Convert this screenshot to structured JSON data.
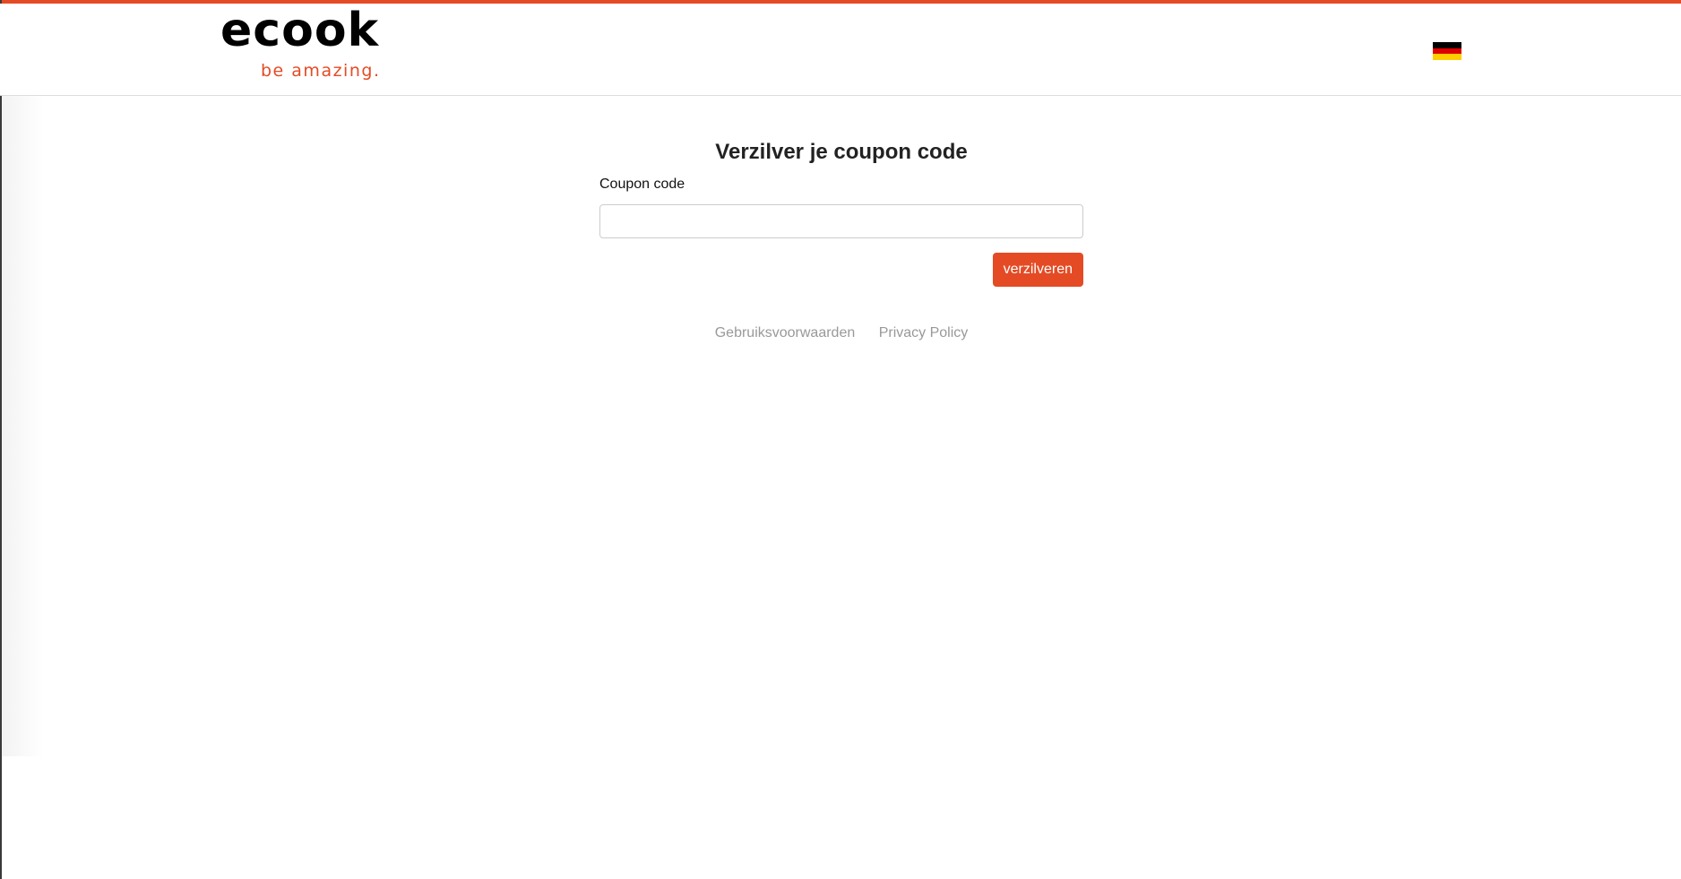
{
  "brand": {
    "name": "ecook",
    "tagline": "be amazing.",
    "accent_color": "#e44b25"
  },
  "header": {
    "language_flag_icon": "german-flag-icon"
  },
  "form": {
    "title": "Verzilver je coupon code",
    "coupon_label": "Coupon code",
    "coupon_value": "",
    "coupon_placeholder": "",
    "submit_label": "verzilveren"
  },
  "footer": {
    "links": [
      {
        "label": "Gebruiksvoorwaarden"
      },
      {
        "label": "Privacy Policy"
      }
    ]
  }
}
